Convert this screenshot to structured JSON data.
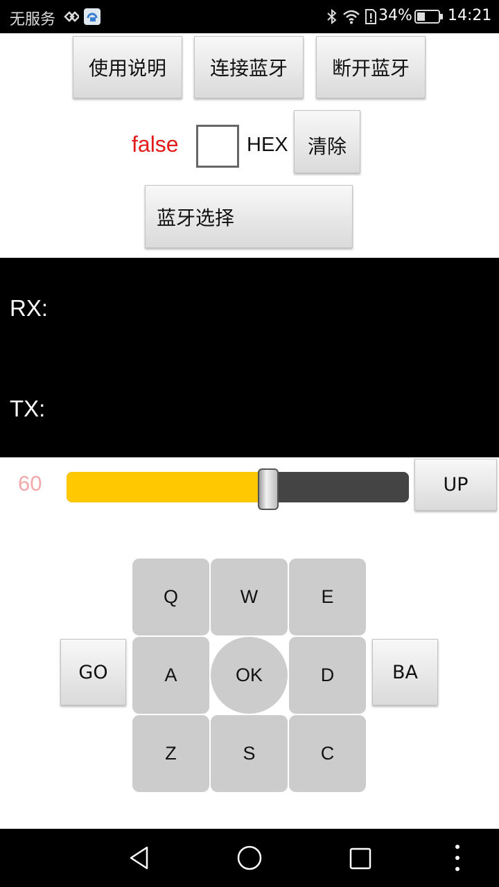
{
  "status_bar": {
    "carrier": "无服务",
    "battery": "34%",
    "time": "14:21",
    "icons": [
      "signal-x-icon",
      "app-icon",
      "bluetooth-icon",
      "wifi-icon",
      "sim-alert-icon",
      "battery-icon"
    ]
  },
  "top_buttons": {
    "instructions": "使用说明",
    "connect": "连接蓝牙",
    "disconnect": "断开蓝牙"
  },
  "options": {
    "status": "false",
    "hex_label": "HEX",
    "hex_checked": false,
    "clear": "清除"
  },
  "bluetooth_select": "蓝牙选择",
  "terminal": {
    "rx_label": "RX:",
    "tx_label": "TX:",
    "background": "#000000"
  },
  "speed": {
    "value": "60",
    "fraction": 0.59,
    "up_label": "UP",
    "fill_color": "#ffc800"
  },
  "keypad": {
    "keys": [
      "Q",
      "W",
      "E",
      "A",
      "OK",
      "D",
      "Z",
      "S",
      "C"
    ],
    "go": "GO",
    "ba": "BA"
  },
  "nav_bar": {
    "icons": [
      "back-icon",
      "home-icon",
      "recents-icon",
      "menu-icon"
    ]
  }
}
